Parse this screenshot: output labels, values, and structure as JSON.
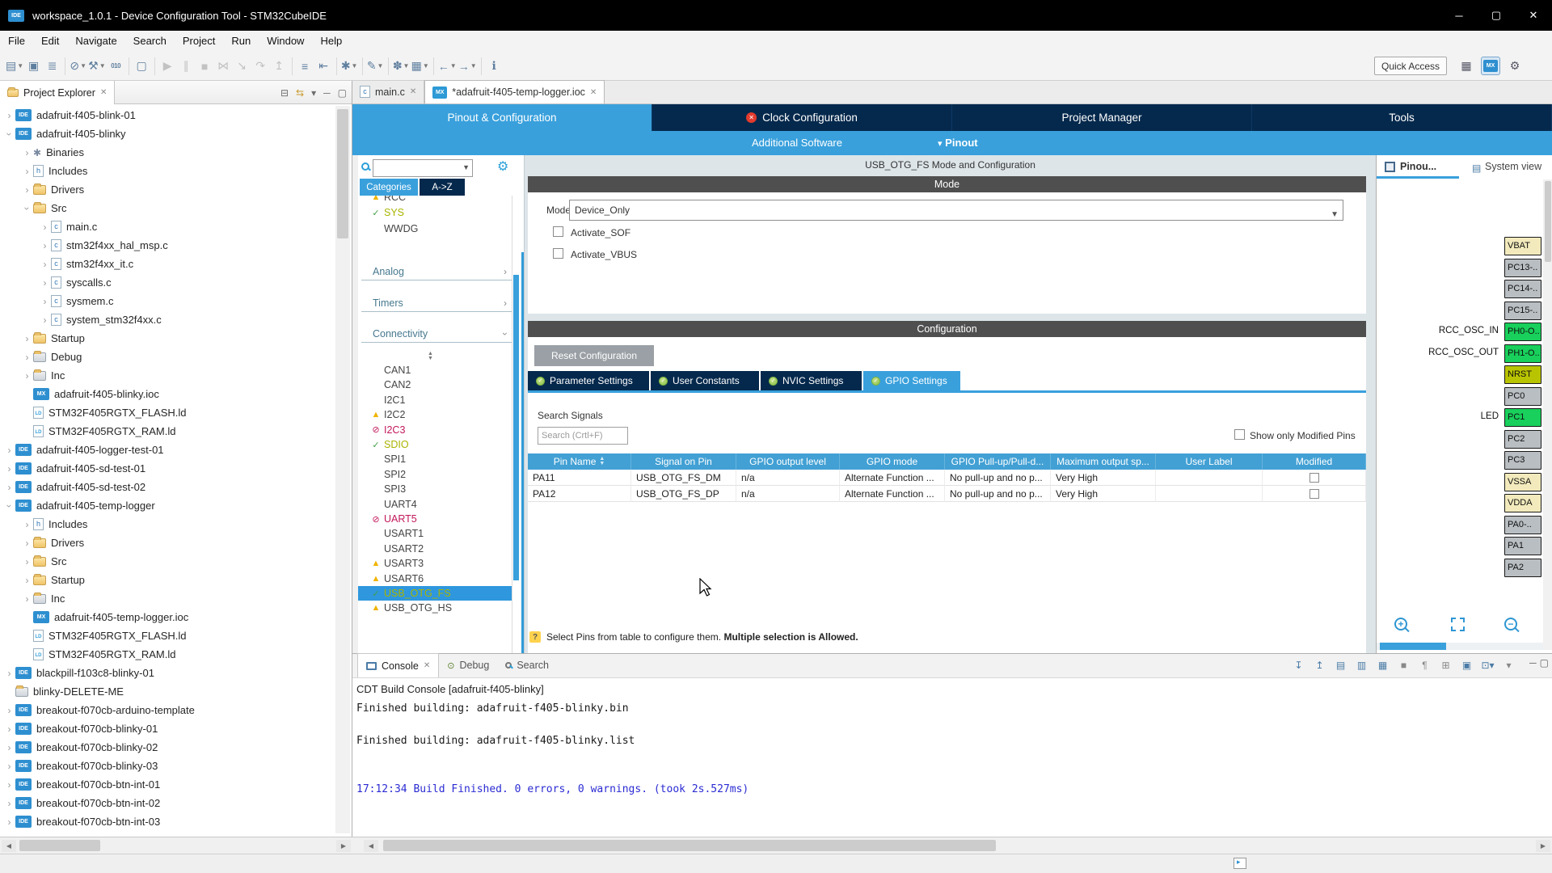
{
  "window": {
    "title": "workspace_1.0.1 - Device Configuration Tool - STM32CubeIDE",
    "app_icon": "IDE",
    "menus": [
      "File",
      "Edit",
      "Navigate",
      "Search",
      "Project",
      "Run",
      "Window",
      "Help"
    ],
    "quick_access": "Quick Access"
  },
  "toolbar": {
    "items": [
      {
        "name": "new",
        "glyph": "▤",
        "dropdown": true
      },
      {
        "name": "save",
        "glyph": "▣"
      },
      {
        "name": "save-all",
        "glyph": "≣"
      },
      {
        "sep": true
      },
      {
        "name": "skip-all-breakpoints",
        "glyph": "⊘",
        "dropdown": true
      },
      {
        "name": "build-all",
        "glyph": "⚒",
        "dropdown": true
      },
      {
        "name": "build-binary",
        "glyph": "010",
        "small": true
      },
      {
        "sep": true
      },
      {
        "name": "open-console-view",
        "glyph": "▢"
      },
      {
        "sep": true
      },
      {
        "name": "resume",
        "glyph": "▶",
        "disabled": true
      },
      {
        "name": "suspend",
        "glyph": "∥",
        "disabled": true
      },
      {
        "name": "terminate",
        "glyph": "■",
        "disabled": true
      },
      {
        "name": "disconnect",
        "glyph": "⋈",
        "disabled": true
      },
      {
        "name": "step-into",
        "glyph": "↘",
        "disabled": true
      },
      {
        "name": "step-over",
        "glyph": "↷",
        "disabled": true
      },
      {
        "name": "step-return",
        "glyph": "↥",
        "disabled": true
      },
      {
        "sep": true
      },
      {
        "name": "mark-occurrences",
        "glyph": "≡"
      },
      {
        "name": "last-edit-location",
        "glyph": "⇤"
      },
      {
        "sep": true
      },
      {
        "name": "new-element",
        "glyph": "✱",
        "dropdown": true
      },
      {
        "sep": true
      },
      {
        "name": "annotate",
        "glyph": "✎",
        "dropdown": true
      },
      {
        "sep": true
      },
      {
        "name": "search-actions",
        "glyph": "✽",
        "dropdown": true
      },
      {
        "name": "open-perspective",
        "glyph": "▦",
        "dropdown": true
      },
      {
        "sep": true
      },
      {
        "name": "back",
        "glyph": "←",
        "dropdown": true
      },
      {
        "name": "forward",
        "glyph": "→",
        "dropdown": true
      },
      {
        "sep": true
      },
      {
        "name": "info",
        "glyph": "ℹ"
      }
    ]
  },
  "project_explorer": {
    "title": "Project Explorer",
    "items": [
      {
        "label": "adafruit-f405-blink-01",
        "depth": 0,
        "icon": "ide",
        "expand": "collapsed"
      },
      {
        "label": "adafruit-f405-blinky",
        "depth": 0,
        "icon": "ide",
        "expand": "expanded"
      },
      {
        "label": "Binaries",
        "depth": 1,
        "icon": "bin",
        "expand": "collapsed"
      },
      {
        "label": "Includes",
        "depth": 1,
        "icon": "inc",
        "expand": "collapsed"
      },
      {
        "label": "Drivers",
        "depth": 1,
        "icon": "folder",
        "expand": "collapsed"
      },
      {
        "label": "Src",
        "depth": 1,
        "icon": "folder",
        "expand": "expanded"
      },
      {
        "label": "main.c",
        "depth": 2,
        "icon": "c",
        "expand": "collapsed"
      },
      {
        "label": "stm32f4xx_hal_msp.c",
        "depth": 2,
        "icon": "c",
        "expand": "collapsed"
      },
      {
        "label": "stm32f4xx_it.c",
        "depth": 2,
        "icon": "c",
        "expand": "collapsed"
      },
      {
        "label": "syscalls.c",
        "depth": 2,
        "icon": "c",
        "expand": "collapsed"
      },
      {
        "label": "sysmem.c",
        "depth": 2,
        "icon": "c",
        "expand": "collapsed"
      },
      {
        "label": "system_stm32f4xx.c",
        "depth": 2,
        "icon": "c",
        "expand": "collapsed"
      },
      {
        "label": "Startup",
        "depth": 1,
        "icon": "folder",
        "expand": "collapsed"
      },
      {
        "label": "Debug",
        "depth": 1,
        "icon": "folder-plain",
        "expand": "collapsed"
      },
      {
        "label": "Inc",
        "depth": 1,
        "icon": "folder-plain",
        "expand": "collapsed"
      },
      {
        "label": "adafruit-f405-blinky.ioc",
        "depth": 1,
        "icon": "mx",
        "expand": "none"
      },
      {
        "label": "STM32F405RGTX_FLASH.ld",
        "depth": 1,
        "icon": "ld",
        "expand": "none"
      },
      {
        "label": "STM32F405RGTX_RAM.ld",
        "depth": 1,
        "icon": "ld",
        "expand": "none"
      },
      {
        "label": "adafruit-f405-logger-test-01",
        "depth": 0,
        "icon": "ide",
        "expand": "collapsed"
      },
      {
        "label": "adafruit-f405-sd-test-01",
        "depth": 0,
        "icon": "ide",
        "expand": "collapsed"
      },
      {
        "label": "adafruit-f405-sd-test-02",
        "depth": 0,
        "icon": "ide",
        "expand": "collapsed"
      },
      {
        "label": "adafruit-f405-temp-logger",
        "depth": 0,
        "icon": "ide",
        "expand": "expanded"
      },
      {
        "label": "Includes",
        "depth": 1,
        "icon": "inc",
        "expand": "collapsed"
      },
      {
        "label": "Drivers",
        "depth": 1,
        "icon": "folder",
        "expand": "collapsed"
      },
      {
        "label": "Src",
        "depth": 1,
        "icon": "folder",
        "expand": "collapsed"
      },
      {
        "label": "Startup",
        "depth": 1,
        "icon": "folder",
        "expand": "collapsed"
      },
      {
        "label": "Inc",
        "depth": 1,
        "icon": "folder-plain",
        "expand": "collapsed"
      },
      {
        "label": "adafruit-f405-temp-logger.ioc",
        "depth": 1,
        "icon": "mx",
        "expand": "none"
      },
      {
        "label": "STM32F405RGTX_FLASH.ld",
        "depth": 1,
        "icon": "ld",
        "expand": "none"
      },
      {
        "label": "STM32F405RGTX_RAM.ld",
        "depth": 1,
        "icon": "ld",
        "expand": "none"
      },
      {
        "label": "blackpill-f103c8-blinky-01",
        "depth": 0,
        "icon": "ide",
        "expand": "collapsed"
      },
      {
        "label": "blinky-DELETE-ME",
        "depth": 0,
        "icon": "folder-plain",
        "expand": "none"
      },
      {
        "label": "breakout-f070cb-arduino-template",
        "depth": 0,
        "icon": "ide",
        "expand": "collapsed"
      },
      {
        "label": "breakout-f070cb-blinky-01",
        "depth": 0,
        "icon": "ide",
        "expand": "collapsed"
      },
      {
        "label": "breakout-f070cb-blinky-02",
        "depth": 0,
        "icon": "ide",
        "expand": "collapsed"
      },
      {
        "label": "breakout-f070cb-blinky-03",
        "depth": 0,
        "icon": "ide",
        "expand": "collapsed"
      },
      {
        "label": "breakout-f070cb-btn-int-01",
        "depth": 0,
        "icon": "ide",
        "expand": "collapsed"
      },
      {
        "label": "breakout-f070cb-btn-int-02",
        "depth": 0,
        "icon": "ide",
        "expand": "collapsed"
      },
      {
        "label": "breakout-f070cb-btn-int-03",
        "depth": 0,
        "icon": "ide",
        "expand": "collapsed"
      }
    ]
  },
  "editor_tabs": [
    {
      "label": "main.c",
      "icon": "c",
      "active": false
    },
    {
      "label": "*adafruit-f405-temp-logger.ioc",
      "icon": "mx",
      "active": true
    }
  ],
  "cube_tabs": [
    {
      "label": "Pinout & Configuration",
      "active": true
    },
    {
      "label": "Clock Configuration",
      "error": true
    },
    {
      "label": "Project Manager"
    },
    {
      "label": "Tools"
    }
  ],
  "secondary_bar": {
    "left": "Additional Software",
    "right": "Pinout"
  },
  "peripherals": {
    "search_value": "",
    "tabs": [
      {
        "label": "Categories",
        "active": true
      },
      {
        "label": "A->Z",
        "active": false
      }
    ],
    "top_items": [
      {
        "label": "RCC",
        "status": "warn"
      },
      {
        "label": "SYS",
        "status": "ok"
      },
      {
        "label": "WWDG",
        "status": "none"
      }
    ],
    "sections": [
      {
        "label": "Analog",
        "state": "collapsed"
      },
      {
        "label": "Timers",
        "state": "collapsed"
      },
      {
        "label": "Connectivity",
        "state": "expanded"
      }
    ],
    "connectivity_items": [
      {
        "label": "CAN1",
        "status": "none"
      },
      {
        "label": "CAN2",
        "status": "none"
      },
      {
        "label": "I2C1",
        "status": "none"
      },
      {
        "label": "I2C2",
        "status": "warn"
      },
      {
        "label": "I2C3",
        "status": "blocked"
      },
      {
        "label": "SDIO",
        "status": "ok"
      },
      {
        "label": "SPI1",
        "status": "none"
      },
      {
        "label": "SPI2",
        "status": "none"
      },
      {
        "label": "SPI3",
        "status": "none"
      },
      {
        "label": "UART4",
        "status": "none"
      },
      {
        "label": "UART5",
        "status": "blocked"
      },
      {
        "label": "USART1",
        "status": "none"
      },
      {
        "label": "USART2",
        "status": "none"
      },
      {
        "label": "USART3",
        "status": "warn"
      },
      {
        "label": "USART6",
        "status": "warn"
      },
      {
        "label": "USB_OTG_FS",
        "status": "ok",
        "selected": true
      },
      {
        "label": "USB_OTG_HS",
        "status": "warn"
      }
    ]
  },
  "mode_panel": {
    "title": "USB_OTG_FS Mode and Configuration",
    "header": "Mode",
    "mode_label": "Mode",
    "mode_value": "Device_Only",
    "checkboxes": [
      {
        "label": "Activate_SOF",
        "checked": false
      },
      {
        "label": "Activate_VBUS",
        "checked": false
      }
    ]
  },
  "config_panel": {
    "header": "Configuration",
    "reset_button": "Reset Configuration",
    "tabs": [
      {
        "label": "Parameter Settings",
        "active": false
      },
      {
        "label": "User Constants",
        "active": false
      },
      {
        "label": "NVIC Settings",
        "active": false
      },
      {
        "label": "GPIO Settings",
        "active": true
      }
    ],
    "search_label": "Search Signals",
    "search_placeholder": "Search (Crtl+F)",
    "show_only_modified": "Show only Modified Pins",
    "table": {
      "columns": [
        "Pin Name",
        "Signal on Pin",
        "GPIO output level",
        "GPIO mode",
        "GPIO Pull-up/Pull-d...",
        "Maximum output sp...",
        "User Label",
        "Modified"
      ],
      "rows": [
        {
          "cells": [
            "PA11",
            "USB_OTG_FS_DM",
            "n/a",
            "Alternate Function ...",
            "No pull-up and no p...",
            "Very High",
            ""
          ],
          "modified": false
        },
        {
          "cells": [
            "PA12",
            "USB_OTG_FS_DP",
            "n/a",
            "Alternate Function ...",
            "No pull-up and no p...",
            "Very High",
            ""
          ],
          "modified": false
        }
      ]
    },
    "hint_normal": "Select Pins from table to configure them. ",
    "hint_bold": "Multiple selection is Allowed."
  },
  "pinout_panel": {
    "tabs": [
      {
        "label": "Pinou...",
        "active": true
      },
      {
        "label": "System view",
        "active": false
      }
    ],
    "pins": [
      {
        "label": "VBAT",
        "color": "cream"
      },
      {
        "label": "PC13-..",
        "color": "gray"
      },
      {
        "label": "PC14-..",
        "color": "gray"
      },
      {
        "label": "PC15-..",
        "color": "gray"
      },
      {
        "label": "PH0-O..",
        "color": "green",
        "annotation": "RCC_OSC_IN"
      },
      {
        "label": "PH1-O..",
        "color": "green",
        "annotation": "RCC_OSC_OUT"
      },
      {
        "label": "NRST",
        "color": "olive"
      },
      {
        "label": "PC0",
        "color": "gray"
      },
      {
        "label": "PC1",
        "color": "green",
        "annotation": "LED"
      },
      {
        "label": "PC2",
        "color": "gray"
      },
      {
        "label": "PC3",
        "color": "gray"
      },
      {
        "label": "VSSA",
        "color": "cream"
      },
      {
        "label": "VDDA",
        "color": "cream"
      },
      {
        "label": "PA0-..",
        "color": "gray"
      },
      {
        "label": "PA1",
        "color": "gray"
      },
      {
        "label": "PA2",
        "color": "gray"
      }
    ]
  },
  "console": {
    "tabs": [
      {
        "label": "Console",
        "active": true,
        "closable": true
      },
      {
        "label": "Debug",
        "active": false
      },
      {
        "label": "Search",
        "active": false
      }
    ],
    "toolbar": [
      {
        "name": "scroll-to-bottom",
        "glyph": "↧",
        "blue": true
      },
      {
        "name": "scroll-to-top",
        "glyph": "↥",
        "blue": true
      },
      {
        "name": "show-console-on-output",
        "glyph": "▤",
        "blue": true
      },
      {
        "name": "show-console-on-error",
        "glyph": "▥",
        "blue": true
      },
      {
        "name": "clear-console",
        "glyph": "▦",
        "blue": true
      },
      {
        "name": "scroll-lock",
        "glyph": "■",
        "blue": false
      },
      {
        "name": "word-wrap",
        "glyph": "¶",
        "blue": false
      },
      {
        "name": "pin-console",
        "glyph": "⊞",
        "blue": false
      },
      {
        "name": "display-selected-console",
        "glyph": "▣",
        "blue": true
      },
      {
        "name": "open-console",
        "glyph": "⊡",
        "blue": true,
        "dropdown": true
      },
      {
        "name": "view-menu",
        "glyph": "▾",
        "blue": false
      }
    ],
    "subtitle": "CDT Build Console [adafruit-f405-blinky]",
    "lines": [
      {
        "text": "Finished building: adafruit-f405-blinky.bin",
        "blue": false
      },
      {
        "text": "",
        "blue": false
      },
      {
        "text": "Finished building: adafruit-f405-blinky.list",
        "blue": false
      },
      {
        "text": "",
        "blue": false
      },
      {
        "text": "",
        "blue": false
      },
      {
        "text": "17:12:34 Build Finished. 0 errors, 0 warnings. (took 2s.527ms)",
        "blue": true
      }
    ]
  },
  "colors": {
    "accent_blue": "#39a0dc",
    "navy": "#05294d",
    "section_header_gray": "#4f4f4f",
    "table_header_blue": "#42a0d4",
    "pin_green": "#18d05b",
    "pin_gray": "#b9bec2",
    "pin_cream": "#f2eabc",
    "pin_olive": "#b9c400",
    "error_red": "#e23b2e",
    "console_info_blue": "#2b2bd4",
    "warn_yellow": "#f0b400",
    "blocked_magenta": "#c2185b",
    "ok_green": "#43a047"
  }
}
